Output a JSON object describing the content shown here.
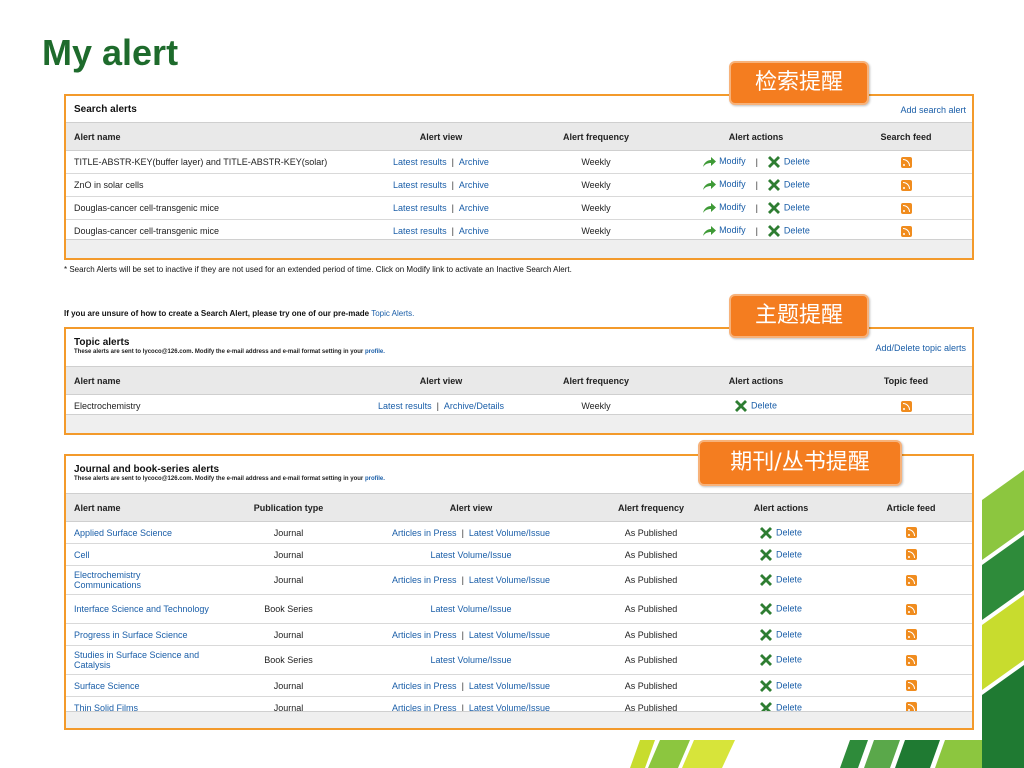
{
  "page": {
    "title": "My alert"
  },
  "callouts": {
    "search": "检索提醒",
    "topic": "主题提醒",
    "journal": "期刊/丛书提醒"
  },
  "colors": {
    "title_green": "#1e6b2c",
    "border_orange": "#f39a2b",
    "callout_orange": "#f47d20",
    "link_blue": "#1a5ea8",
    "rss_orange": "#f08c1e"
  },
  "icons": {
    "modify": "modify-arrow-icon",
    "delete": "delete-x-icon",
    "feed": "rss-feed-icon"
  },
  "search_alerts": {
    "heading": "Search alerts",
    "add_link": "Add search alert",
    "columns": [
      "Alert name",
      "Alert view",
      "Alert frequency",
      "Alert actions",
      "Search feed"
    ],
    "rows": [
      {
        "name": "TITLE-ABSTR-KEY(buffer layer) and TITLE-ABSTR-KEY(solar)",
        "view1": "Latest results",
        "sep": "|",
        "view2": "Archive",
        "freq": "Weekly",
        "modify": "Modify",
        "delete": "Delete"
      },
      {
        "name": "ZnO in solar cells",
        "view1": "Latest results",
        "sep": "|",
        "view2": "Archive",
        "freq": "Weekly",
        "modify": "Modify",
        "delete": "Delete"
      },
      {
        "name": "Douglas-cancer cell-transgenic mice",
        "view1": "Latest results",
        "sep": "|",
        "view2": "Archive",
        "freq": "Weekly",
        "modify": "Modify",
        "delete": "Delete"
      },
      {
        "name": "Douglas-cancer cell-transgenic mice",
        "view1": "Latest results",
        "sep": "|",
        "view2": "Archive",
        "freq": "Weekly",
        "modify": "Modify",
        "delete": "Delete"
      }
    ]
  },
  "inactive_note": "* Search Alerts will be set to inactive if they are not used for an extended period of time. Click on Modify link to activate an Inactive Search Alert.",
  "premade_note": {
    "text": "If you are unsure of how to create a Search Alert, please try one of our pre-made",
    "link": "Topic Alerts."
  },
  "topic_alerts": {
    "heading": "Topic alerts",
    "sub_text": "These alerts are sent to lycoco@126.com. Modify the e-mail address and e-mail format setting in your",
    "sub_link": "profile.",
    "add_link": "Add/Delete topic alerts",
    "columns": [
      "Alert name",
      "Alert view",
      "Alert frequency",
      "Alert actions",
      "Topic feed"
    ],
    "rows": [
      {
        "name": "Electrochemistry",
        "view1": "Latest results",
        "sep": "|",
        "view2": "Archive/Details",
        "freq": "Weekly",
        "delete": "Delete"
      }
    ]
  },
  "journal_alerts": {
    "heading": "Journal and book-series alerts",
    "sub_text": "These alerts are sent to lycoco@126.com. Modify the e-mail address and e-mail format setting in your",
    "sub_link": "profile.",
    "columns": [
      "Alert name",
      "Publication type",
      "Alert view",
      "Alert frequency",
      "Alert actions",
      "Article feed"
    ],
    "rows": [
      {
        "name": "Applied Surface Science",
        "type": "Journal",
        "view1": "Articles in Press",
        "sep": "|",
        "view2": "Latest Volume/Issue",
        "freq": "As Published",
        "delete": "Delete"
      },
      {
        "name": "Cell",
        "type": "Journal",
        "view1": "",
        "sep": "",
        "view2": "Latest Volume/Issue",
        "freq": "As Published",
        "delete": "Delete"
      },
      {
        "name": "Electrochemistry Communications",
        "type": "Journal",
        "view1": "Articles in Press",
        "sep": "|",
        "view2": "Latest Volume/Issue",
        "freq": "As Published",
        "delete": "Delete"
      },
      {
        "name": "Interface Science and Technology",
        "type": "Book Series",
        "view1": "",
        "sep": "",
        "view2": "Latest Volume/Issue",
        "freq": "As Published",
        "delete": "Delete"
      },
      {
        "name": "Progress in Surface Science",
        "type": "Journal",
        "view1": "Articles in Press",
        "sep": "|",
        "view2": "Latest Volume/Issue",
        "freq": "As Published",
        "delete": "Delete"
      },
      {
        "name": "Studies in Surface Science and Catalysis",
        "type": "Book Series",
        "view1": "",
        "sep": "",
        "view2": "Latest Volume/Issue",
        "freq": "As Published",
        "delete": "Delete"
      },
      {
        "name": "Surface Science",
        "type": "Journal",
        "view1": "Articles in Press",
        "sep": "|",
        "view2": "Latest Volume/Issue",
        "freq": "As Published",
        "delete": "Delete"
      },
      {
        "name": "Thin Solid Films",
        "type": "Journal",
        "view1": "Articles in Press",
        "sep": "|",
        "view2": "Latest Volume/Issue",
        "freq": "As Published",
        "delete": "Delete"
      }
    ]
  }
}
